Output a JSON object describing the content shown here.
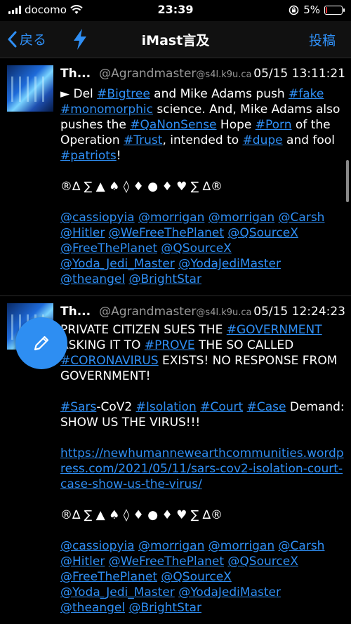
{
  "status": {
    "carrier": "docomo",
    "time": "23:39",
    "battery_text": "5%",
    "battery_level": 0.05
  },
  "nav": {
    "back_label": "戻る",
    "title": "iMast言及",
    "post_label": "投稿"
  },
  "posts": [
    {
      "name": "Th...",
      "acct": "@Agrandmaster",
      "host": "@s4l.k9u.ca",
      "time": "05/15 13:11:21",
      "t1": "► Del ",
      "h1": "#Bigtree",
      "t2": " and Mike Adams push ",
      "h2": "#fake",
      "h3": "#monomorphic",
      "t3": " science. And, Mike Adams also pushes the ",
      "h4": "#QaNonSense",
      "t4": " Hope ",
      "h5": "#Porn",
      "t5": " of the Operation ",
      "h6": "#Trust",
      "t6": ", intended to ",
      "h7": "#dupe",
      "t7": " and fool ",
      "h8": "#patriots",
      "t8": "!",
      "symbols": "®∆ ∑ ▲ ♠ ◊ ♦ ● ♦ ♥ ∑ ∆®",
      "mentions": [
        "@cassiopyia",
        "@morrigan",
        "@morrigan",
        "@Carsh",
        "@Hitler",
        "@WeFreeThePlanet",
        "@QSourceX",
        "@FreeThePlanet",
        "@QSourceX",
        "@Yoda_Jedi_Master",
        "@YodaJediMaster",
        "@theangel",
        "@BrightStar"
      ]
    },
    {
      "name": "Th...",
      "acct": "@Agrandmaster",
      "host": "@s4l.k9u.ca",
      "time": "05/15 12:24:23",
      "t1": "PRIVATE CITIZEN SUES THE ",
      "h1": "#GOVERNMENT",
      "t2": " ASKING IT TO ",
      "h2": "#PROVE",
      "t3": " THE SO CALLED ",
      "h3": "#CORONAVIRUS",
      "t4": " EXISTS! NO RESPONSE FROM GOVERNMENT!",
      "h4": "#Sars",
      "t5": "-CoV2 ",
      "h5": "#Isolation",
      "h6": "#Court",
      "h7": "#Case",
      "t6": " Demand: SHOW US THE VIRUS!!!",
      "link": "https://newhumannewearthcommunities.wordpress.com/2021/05/11/sars-cov2-isolation-court-case-show-us-the-virus/",
      "symbols": "®∆ ∑ ▲ ♠ ◊ ♦ ● ♦ ♥ ∑ ∆®",
      "mentions": [
        "@cassiopyia",
        "@morrigan",
        "@morrigan",
        "@Carsh",
        "@Hitler",
        "@WeFreeThePlanet",
        "@QSourceX",
        "@FreeThePlanet",
        "@QSourceX",
        "@Yoda_Jedi_Master",
        "@YodaJediMaster",
        "@theangel",
        "@BrightStar"
      ]
    }
  ]
}
